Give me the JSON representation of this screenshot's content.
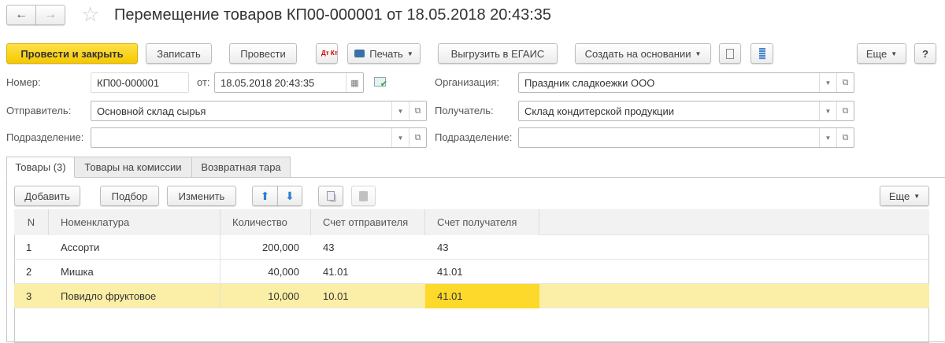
{
  "header": {
    "title": "Перемещение товаров КП00-000001 от 18.05.2018 20:43:35",
    "back_icon": "←",
    "forward_icon": "→",
    "star_icon": "☆"
  },
  "toolbar": {
    "post_close": "Провести и закрыть",
    "save": "Записать",
    "post": "Провести",
    "dtkt": "Дт Кт",
    "print": "Печать",
    "egais": "Выгрузить в ЕГАИС",
    "create_based": "Создать на основании",
    "more": "Еще",
    "help": "?"
  },
  "form": {
    "number_label": "Номер:",
    "number_value": "КП00-000001",
    "date_label": "от:",
    "date_value": "18.05.2018 20:43:35",
    "org_label": "Организация:",
    "org_value": "Праздник сладкоежки ООО",
    "sender_label": "Отправитель:",
    "sender_value": "Основной склад сырья",
    "receiver_label": "Получатель:",
    "receiver_value": "Склад кондитерской продукции",
    "dept_label": "Подразделение:",
    "dept_value": "",
    "dept2_label": "Подразделение:",
    "dept2_value": ""
  },
  "tabs": [
    {
      "label": "Товары (3)"
    },
    {
      "label": "Товары на комиссии"
    },
    {
      "label": "Возвратная тара"
    }
  ],
  "table_toolbar": {
    "add": "Добавить",
    "pick": "Подбор",
    "edit": "Изменить",
    "more": "Еще"
  },
  "table": {
    "columns": [
      "N",
      "Номенклатура",
      "Количество",
      "Счет отправителя",
      "Счет получателя"
    ],
    "rows": [
      {
        "n": "1",
        "item": "Ассорти",
        "qty": "200,000",
        "acc_from": "43",
        "acc_to": "43"
      },
      {
        "n": "2",
        "item": "Мишка",
        "qty": "40,000",
        "acc_from": "41.01",
        "acc_to": "41.01"
      },
      {
        "n": "3",
        "item": "Повидло фруктовое",
        "qty": "10,000",
        "acc_from": "10.01",
        "acc_to": "41.01"
      }
    ]
  },
  "colors": {
    "accent": "#f5c800",
    "selected_row": "#fbeea6",
    "selected_cell": "#fcd92a"
  }
}
